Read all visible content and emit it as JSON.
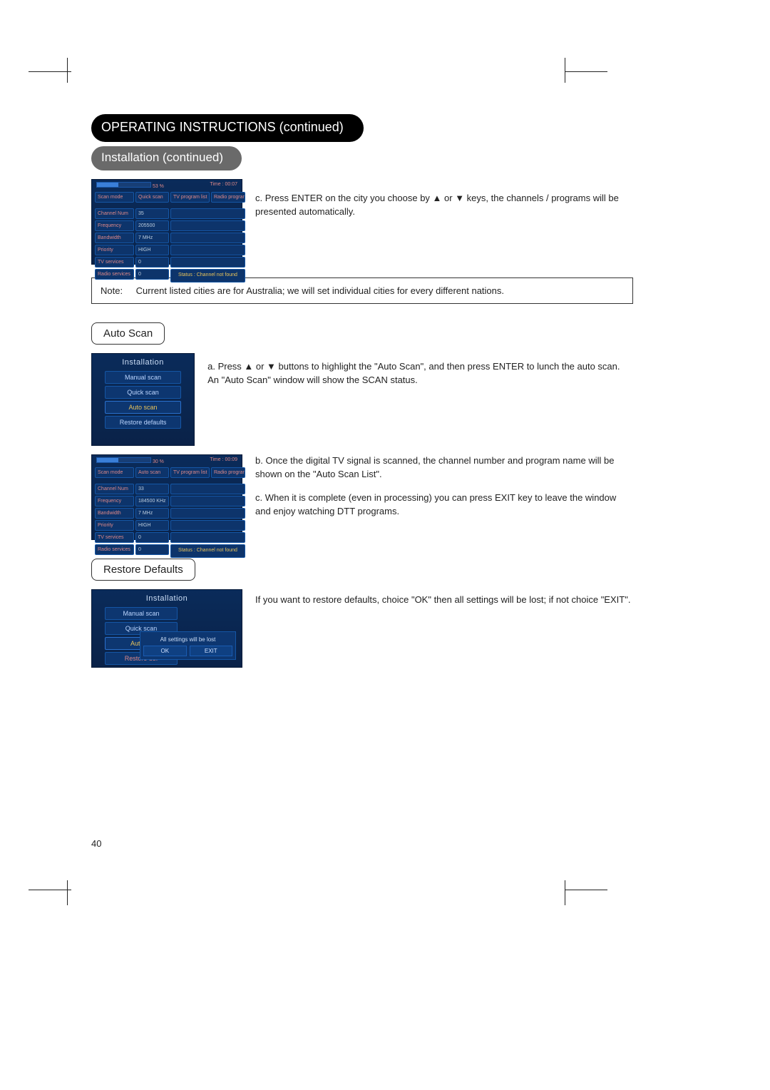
{
  "header": {
    "main_title": "OPERATING INSTRUCTIONS (continued)",
    "sub_title": "Installation (continued)"
  },
  "scan_table_1": {
    "progress_pct": "53 %",
    "time_label": "Time : 00:07",
    "col_tv": "TV program list",
    "col_radio": "Radio program list",
    "rows": [
      {
        "label": "Scan mode",
        "value": "Quick scan"
      },
      {
        "label": "Channel Num",
        "value": "35"
      },
      {
        "label": "Frequency",
        "value": "205500"
      },
      {
        "label": "Bandwidth",
        "value": "7 MHz"
      },
      {
        "label": "Priority",
        "value": "HIGH"
      },
      {
        "label": "TV services",
        "value": "0"
      },
      {
        "label": "Radio services",
        "value": "0"
      }
    ],
    "status": "Status : Channel not found"
  },
  "step_c_text": "c. Press ENTER on the city you choose by ▲ or ▼ keys, the channels / programs will be presented automatically.",
  "note": {
    "label": "Note:",
    "text": "Current listed cities are for Australia; we will set individual cities for every different nations."
  },
  "auto_scan": {
    "label": "Auto Scan",
    "menu_title": "Installation",
    "menu_items": [
      "Manual scan",
      "Quick scan",
      "Auto scan",
      "Restore defaults"
    ],
    "menu_selected_index": 2,
    "step_a": "a. Press ▲ or ▼ buttons to highlight the \"Auto Scan\", and then press ENTER to lunch the auto scan. An \"Auto Scan\" window will show the SCAN status.",
    "progress_pct": "30 %",
    "time_label": "Time : 00:09",
    "col_tv": "TV program list",
    "col_radio": "Radio program list",
    "rows": [
      {
        "label": "Scan mode",
        "value": "Auto scan"
      },
      {
        "label": "Channel Num",
        "value": "33"
      },
      {
        "label": "Frequency",
        "value": "184500 KHz"
      },
      {
        "label": "Bandwidth",
        "value": "7 MHz"
      },
      {
        "label": "Priority",
        "value": "HIGH"
      },
      {
        "label": "TV services",
        "value": "0"
      },
      {
        "label": "Radio services",
        "value": "0"
      }
    ],
    "status": "Status : Channel not found",
    "step_b": "b. Once the digital TV signal is scanned, the channel number and program name will be shown on the \"Auto Scan List\".",
    "step_c": "c. When it is complete (even in processing) you can press EXIT key to leave the window and enjoy watching DTT programs."
  },
  "restore": {
    "label": "Restore Defaults",
    "menu_title": "Installation",
    "menu_items": [
      "Manual scan",
      "Quick scan",
      "Auto sc",
      "Restore def"
    ],
    "dialog_msg": "All settings will be lost",
    "ok": "OK",
    "exit": "EXIT",
    "text": "If you want to restore defaults, choice \"OK\" then all settings will be lost; if not choice \"EXIT\"."
  },
  "page_number": "40"
}
